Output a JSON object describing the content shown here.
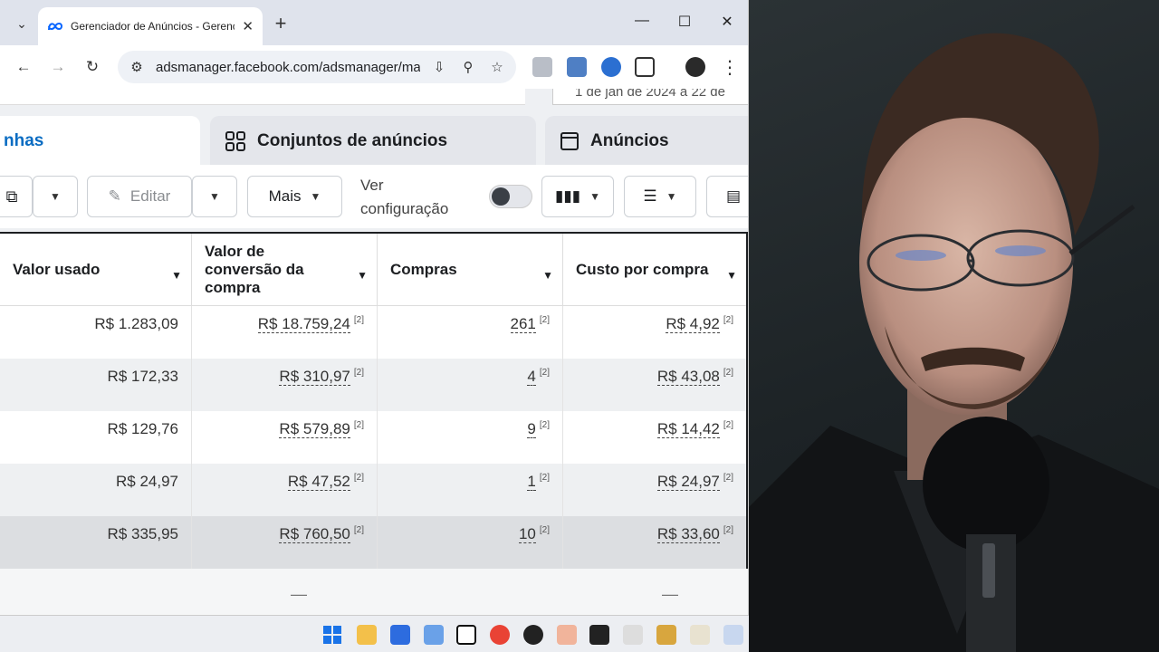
{
  "browser": {
    "tab_title": "Gerenciador de Anúncios - Gerenciar",
    "url": "adsmanager.facebook.com/adsmanager/ma...",
    "new_tab": "+",
    "close_tab": "✕"
  },
  "page": {
    "date_range_partial": "1 de jan de 2024 a 22 de",
    "tabs": [
      {
        "label": "nhas"
      },
      {
        "label": "Conjuntos de anúncios"
      },
      {
        "label": "Anúncios"
      }
    ],
    "actions": {
      "edit": "Editar",
      "more": "Mais",
      "view_config_line1": "Ver",
      "view_config_line2": "configuração"
    },
    "table": {
      "columns": [
        "Valor usado",
        "Valor de conversão da compra",
        "Compras",
        "Custo por compra"
      ],
      "note_marker": "[2]",
      "rows": [
        {
          "spent": "R$ 1.283,09",
          "conv_value": "R$ 18.759,24",
          "purchases": "261",
          "cost_per": "R$ 4,92"
        },
        {
          "spent": "R$ 172,33",
          "conv_value": "R$ 310,97",
          "purchases": "4",
          "cost_per": "R$ 43,08"
        },
        {
          "spent": "R$ 129,76",
          "conv_value": "R$ 579,89",
          "purchases": "9",
          "cost_per": "R$ 14,42"
        },
        {
          "spent": "R$ 24,97",
          "conv_value": "R$ 47,52",
          "purchases": "1",
          "cost_per": "R$ 24,97"
        },
        {
          "spent": "R$ 335,95",
          "conv_value": "R$ 760,50",
          "purchases": "10",
          "cost_per": "R$ 33,60"
        }
      ],
      "footer_dash": "—"
    }
  },
  "colors": {
    "accent": "#0a6cc2",
    "tab_bar": "#dfe3ec",
    "row_alt": "#eef0f2",
    "row_total": "#dcdee1"
  }
}
